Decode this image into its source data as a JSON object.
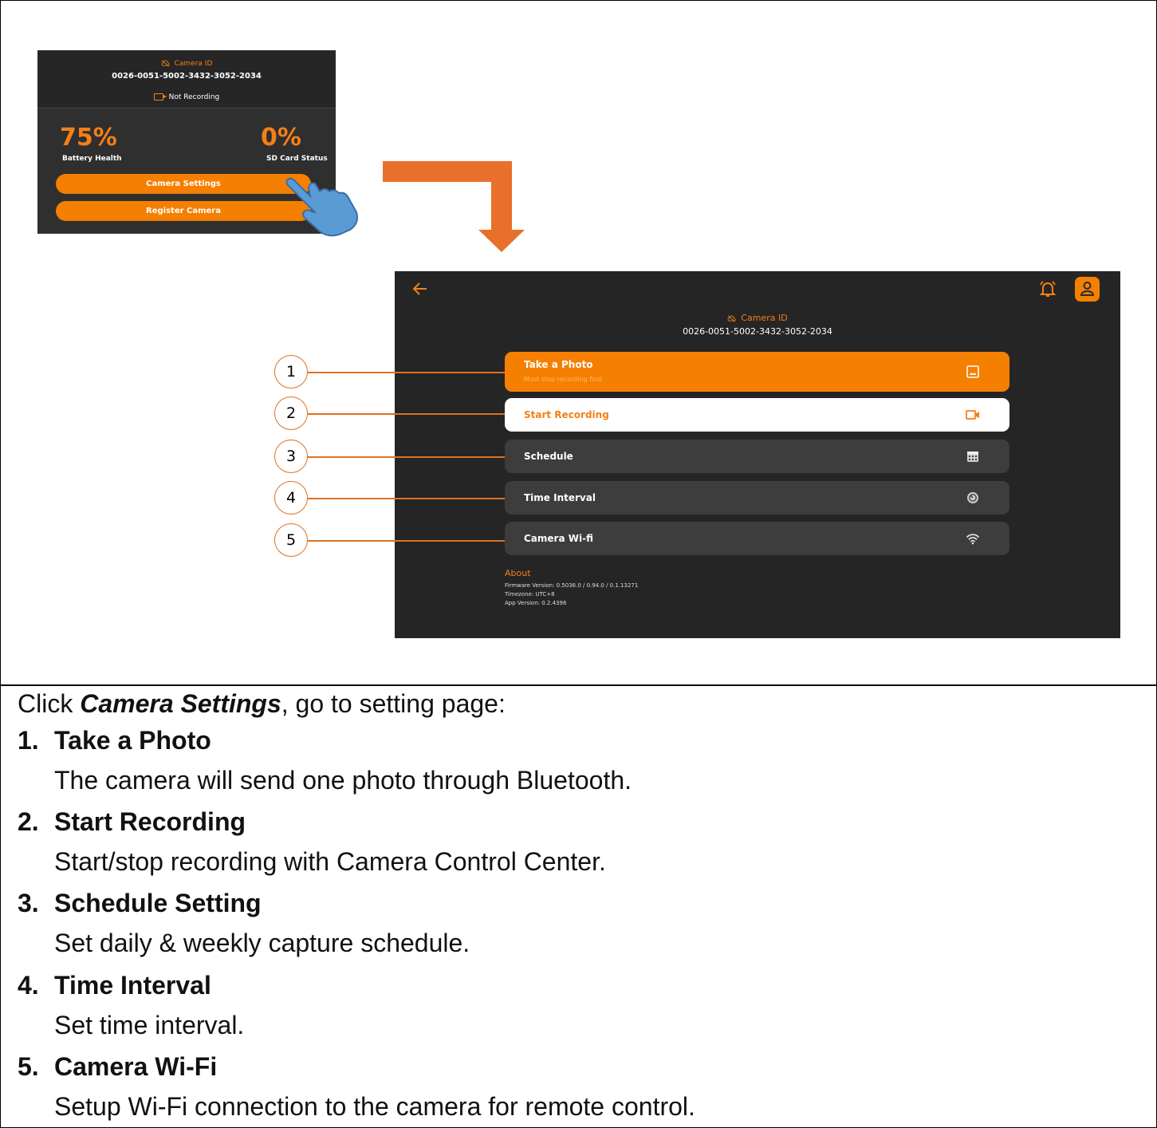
{
  "mini_dashboard": {
    "camera_id_label": "Camera ID",
    "camera_id": "0026-0051-5002-3432-3052-2034",
    "recording_status": "Not Recording",
    "battery_value": "75%",
    "battery_label": "Battery Health",
    "sd_value": "0%",
    "sd_label": "SD Card Status",
    "camera_settings_button": "Camera Settings",
    "register_camera_button": "Register Camera"
  },
  "settings_screen": {
    "camera_id_label": "Camera ID",
    "camera_id": "0026-0051-5002-3432-3052-2034",
    "menu": {
      "photo": {
        "label": "Take a Photo",
        "sub": "Must stop recording first",
        "icon": "image-icon"
      },
      "recording": {
        "label": "Start Recording",
        "icon": "video-camera-icon"
      },
      "schedule": {
        "label": "Schedule",
        "icon": "calendar-icon"
      },
      "time_interval": {
        "label": "Time Interval",
        "icon": "timer-icon"
      },
      "wifi": {
        "label": "Camera Wi-fi",
        "icon": "wifi-icon"
      }
    },
    "about": {
      "title": "About",
      "firmware": "Firmware Version: 0.5036.0 / 0.94.0 / 0.1.13271",
      "timezone": "Timezone: UTC+8",
      "app_version": "App Version: 0.2.4396"
    }
  },
  "callouts": [
    "1",
    "2",
    "3",
    "4",
    "5"
  ],
  "instructions": {
    "intro_prefix": "Click ",
    "intro_emphasis": "Camera Settings",
    "intro_suffix": ", go to setting page:",
    "steps": [
      {
        "num": "1.",
        "title": "Take a Photo",
        "desc": "The camera will send one photo through Bluetooth."
      },
      {
        "num": "2.",
        "title": "Start Recording",
        "desc": "Start/stop recording with Camera Control Center."
      },
      {
        "num": "3.",
        "title": "Schedule Setting",
        "desc": "Set daily & weekly capture schedule."
      },
      {
        "num": "4.",
        "title": "Time Interval",
        "desc": "Set time interval."
      },
      {
        "num": "5.",
        "title": "Camera Wi-Fi",
        "desc": "Setup Wi-Fi connection to the camera for remote control."
      }
    ]
  },
  "colors": {
    "accent": "#f57f00",
    "panel": "#252525",
    "callout": "#e07020"
  }
}
